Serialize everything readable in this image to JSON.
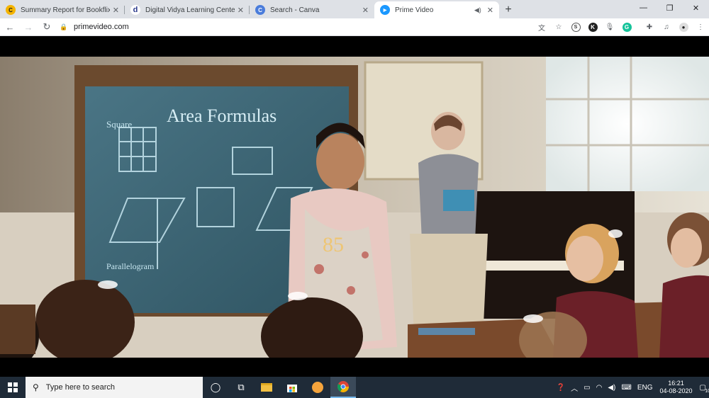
{
  "tabs": [
    {
      "title": "Summary Report for Bookflixing",
      "favicon": "C",
      "favicon_color": "#f4b400"
    },
    {
      "title": "Digital Vidya Learning Center",
      "favicon": "d",
      "favicon_color": "#2b3a8c"
    },
    {
      "title": "Search - Canva",
      "favicon": "C",
      "favicon_color": "#4a7cdb"
    },
    {
      "title": "Prime Video",
      "favicon": "▶",
      "favicon_color": "#1a98ff"
    }
  ],
  "address": {
    "url": "primevideo.com"
  },
  "video_overlay": {
    "chalk_title": "Area Formulas",
    "chalk_square": "Square",
    "chalk_para": "Parallelogram",
    "numbers": "85"
  },
  "taskbar": {
    "search_placeholder": "Type here to search",
    "lang": "ENG",
    "time": "16:21",
    "date": "04-08-2020",
    "notifications": "10"
  },
  "colors": {
    "tabstrip": "#dee1e6",
    "taskbar": "#1f2b38",
    "chalkboard": "#3e6774",
    "prime_blue": "#1a98ff"
  }
}
